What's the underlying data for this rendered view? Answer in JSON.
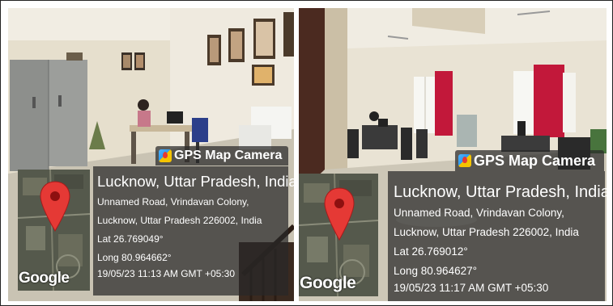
{
  "photos": [
    {
      "app_label": "GPS Map Camera",
      "city": "Lucknow, Uttar Pradesh, India",
      "address_line1": "Unnamed Road, Vrindavan Colony,",
      "address_line2": "Lucknow, Uttar Pradesh 226002, India",
      "lat": "Lat 26.769049°",
      "long": "Long 80.964662°",
      "timestamp": "19/05/23 11:13 AM GMT +05:30",
      "map_brand": "Google"
    },
    {
      "app_label": "GPS Map Camera",
      "city": "Lucknow, Uttar Pradesh, India",
      "address_line1": "Unnamed Road, Vrindavan Colony,",
      "address_line2": "Lucknow, Uttar Pradesh 226002, India",
      "lat": "Lat 26.769012°",
      "long": "Long 80.964627°",
      "timestamp": "19/05/23 11:17 AM GMT +05:30",
      "map_brand": "Google"
    }
  ],
  "colors": {
    "overlay": "#282828",
    "pin": "#e53935",
    "curtain": "#c2183a",
    "wall": "#e9e3d4"
  }
}
